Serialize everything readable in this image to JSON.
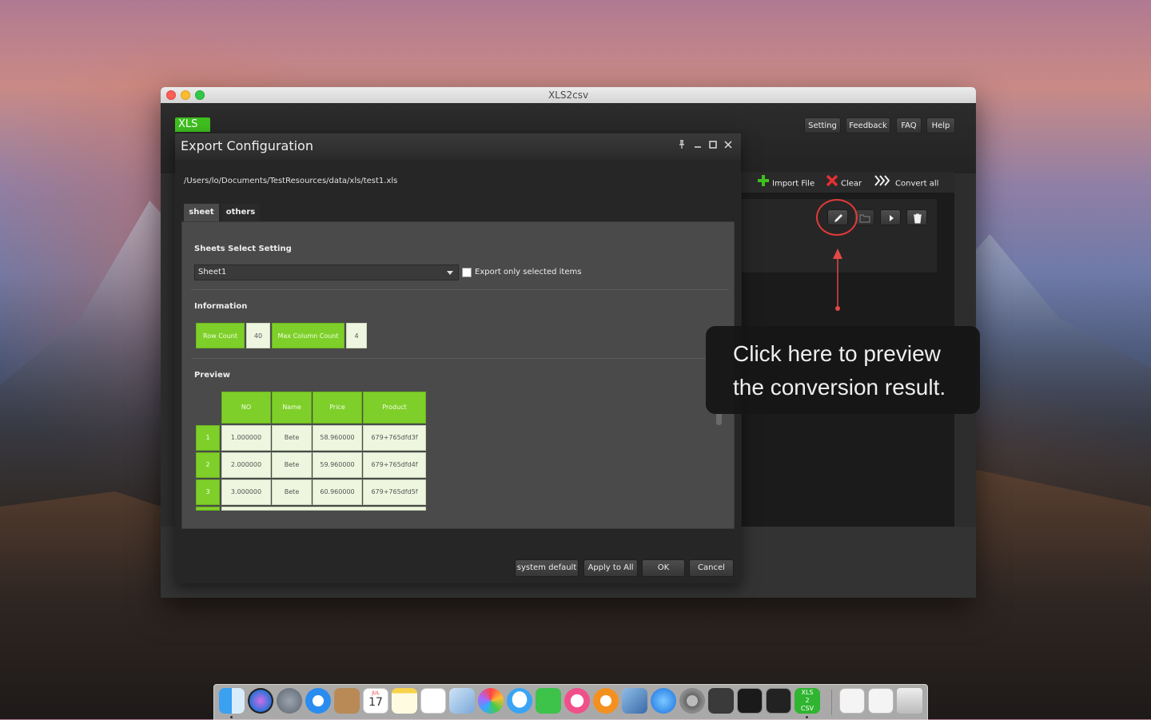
{
  "window": {
    "title": "XLS2csv"
  },
  "app": {
    "logo": "XLS",
    "top_buttons": [
      "Setting",
      "Feedback",
      "FAQ",
      "Help"
    ],
    "toolbar": {
      "import": "Import File",
      "clear": "Clear",
      "convert_all": "Convert all"
    },
    "row_actions": [
      "edit-icon",
      "folder-icon",
      "play-icon",
      "trash-icon"
    ]
  },
  "dialog": {
    "title": "Export Configuration",
    "path": "/Users/lo/Documents/TestResources/data/xls/test1.xls",
    "tabs": [
      "sheet",
      "others"
    ],
    "sheets_section": "Sheets Select Setting",
    "sheet_selected": "Sheet1",
    "export_only_label": "Export only selected items",
    "information_section": "Information",
    "info": {
      "row_count_label": "Row Count",
      "row_count": "40",
      "max_col_label": "Max Column Count",
      "max_col": "4"
    },
    "preview_section": "Preview",
    "preview": {
      "columns": [
        "NO",
        "Name",
        "Price",
        "Product"
      ],
      "rows": [
        [
          "1",
          "1.000000",
          "Bete",
          "58.960000",
          "679+765dfd3f"
        ],
        [
          "2",
          "2.000000",
          "Bete",
          "59.960000",
          "679+765dfd4f"
        ],
        [
          "3",
          "3.000000",
          "Bete",
          "60.960000",
          "679+765dfd5f"
        ]
      ]
    },
    "buttons": {
      "system_default": "system default",
      "apply_all": "Apply to All",
      "ok": "OK",
      "cancel": "Cancel"
    }
  },
  "annotation": {
    "line1": "Click here to preview",
    "line2": "the conversion result."
  },
  "dock": {
    "icons": [
      "finder-icon",
      "siri-icon",
      "launchpad-icon",
      "safari-icon",
      "contacts-icon",
      "calendar-icon",
      "notes-icon",
      "reminders-icon",
      "preview-icon",
      "photos-icon",
      "messages-icon",
      "facetime-icon",
      "itunes-icon",
      "ibooks-icon",
      "preview2-icon",
      "appstore-icon",
      "system-preferences-icon",
      "sublime-icon",
      "terminal-icon",
      "activity-monitor-icon",
      "xls2csv-icon"
    ],
    "calendar_month": "JUL",
    "calendar_day": "17",
    "xls2csv_top": "XLS",
    "xls2csv_mid": "2",
    "xls2csv_bottom": "CSV"
  }
}
